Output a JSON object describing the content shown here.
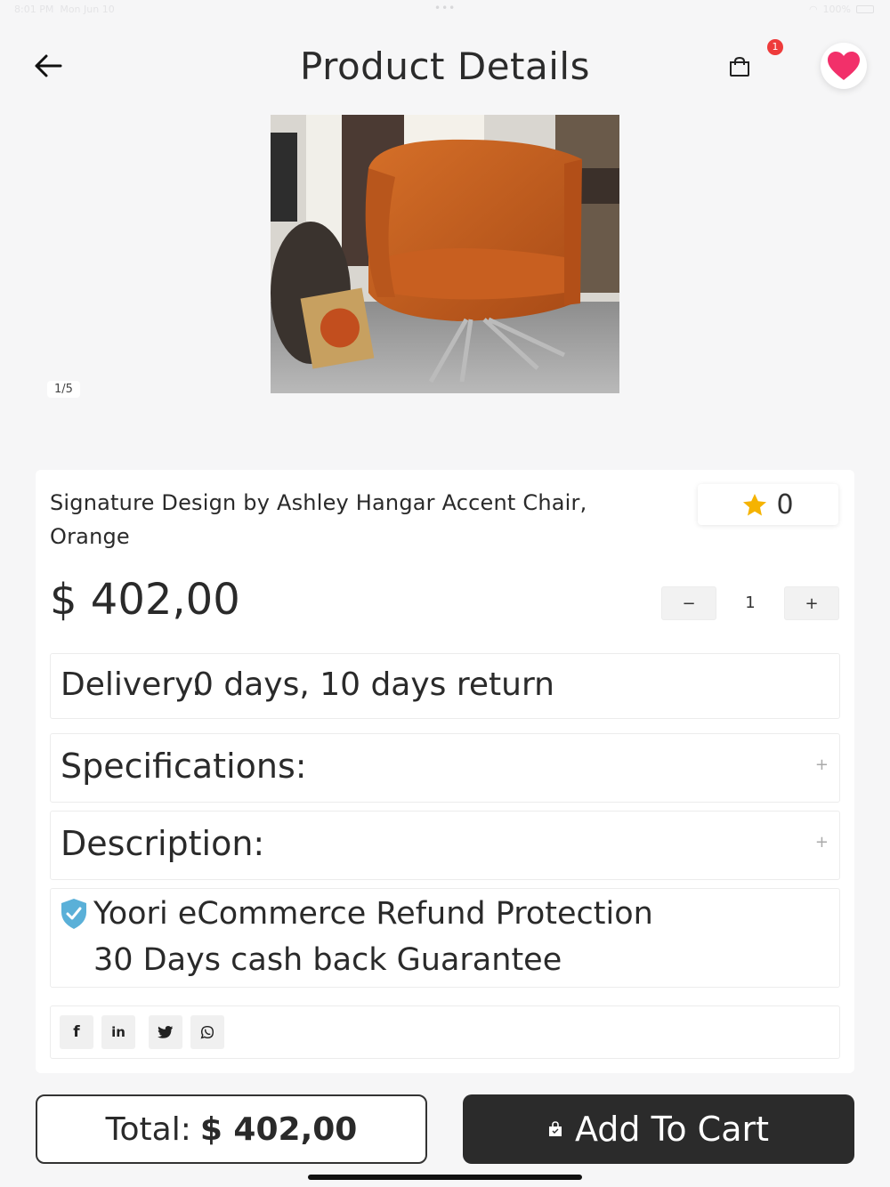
{
  "status_bar": {
    "time": "8:01 PM",
    "date": "Mon Jun 10",
    "battery": "100%"
  },
  "header": {
    "title": "Product Details",
    "cart_count": "1"
  },
  "gallery": {
    "counter": "1/5"
  },
  "product": {
    "name": "Signature Design by Ashley Hangar Accent Chair, Orange",
    "rating": "0",
    "price": "$ 402,00",
    "quantity": "1",
    "qty_minus": "−",
    "qty_plus": "+"
  },
  "delivery": {
    "label": "Delivery:",
    "value": "0 days, 10 days return"
  },
  "accordions": {
    "specifications": "Specifications:",
    "description": "Description:",
    "expand": "+"
  },
  "refund": {
    "line1": "Yoori eCommerce Refund Protection",
    "line2": "30 Days cash back Guarantee"
  },
  "share": {
    "icons": [
      "facebook-icon",
      "linkedin-icon",
      "twitter-icon",
      "whatsapp-icon"
    ],
    "facebook": "f",
    "linkedin": "in"
  },
  "footer": {
    "total_label": "Total:",
    "total_value": "$ 402,00",
    "add_to_cart": "Add To Cart"
  },
  "colors": {
    "accent_dark": "#2b2b2b",
    "heart": "#f2306a",
    "badge": "#ee3b3b",
    "star": "#f5b301",
    "shield": "#5ab0d8"
  }
}
